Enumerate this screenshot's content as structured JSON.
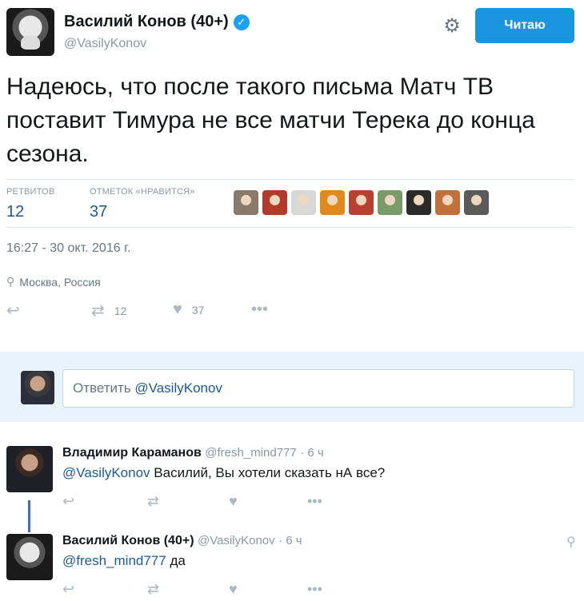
{
  "author": {
    "name": "Василий Конов (40+)",
    "handle": "@VasilyKonov",
    "verified_badge": "✓"
  },
  "follow_button": {
    "label": "Читаю"
  },
  "tweet": {
    "text": "Надеюсь, что после такого письма Матч ТВ поставит Тимура не все матчи Терека до конца сезона.",
    "stats": {
      "retweets_label": "РЕТВИТОВ",
      "retweets_value": "12",
      "likes_label": "ОТМЕТОК «НРАВИТСЯ»",
      "likes_value": "37"
    },
    "liker_colors": [
      "#8a7a6a",
      "#b23a2a",
      "#d8d8d8",
      "#e08a1e",
      "#b84030",
      "#7a9a6a",
      "#2a2a2a",
      "#c0703a",
      "#5a5a5a"
    ],
    "timestamp": "16:27 - 30 окт. 2016 г.",
    "location": "Москва, Россия",
    "actions": {
      "retweets": "12",
      "likes": "37"
    }
  },
  "reply_box": {
    "prefix": "Ответить ",
    "mention": "@VasilyKonov"
  },
  "replies": [
    {
      "name": "Владимир Караманов",
      "handle": "@fresh_mind777",
      "time": "· 6 ч",
      "mention": "@VasilyKonov",
      "text": " Василий, Вы хотели сказать нА все?"
    },
    {
      "name": "Василий Конов (40+)",
      "handle": "@VasilyKonov",
      "time": "· 6 ч",
      "mention": "@fresh_mind777",
      "text": " да"
    }
  ],
  "icons": {
    "gear": "gear-icon",
    "reply": "reply-icon",
    "retweet": "retweet-icon",
    "like": "heart-icon",
    "more": "more-icon",
    "pin": "location-pin-icon"
  }
}
